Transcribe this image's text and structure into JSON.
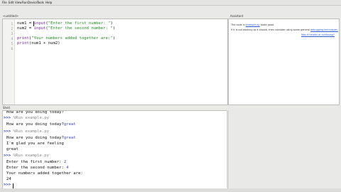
{
  "menu": [
    "File",
    "Edit",
    "View",
    "Run",
    "Device",
    "Tools",
    "Help"
  ],
  "panes": {
    "editor_title": "<untitled>",
    "assistant_title": "Assistant",
    "shell_title": "Shell"
  },
  "editor": {
    "line_numbers": [
      "1",
      "2",
      "3",
      "4",
      "5",
      "6"
    ],
    "lines": [
      {
        "t1": "num1 = ",
        "fn": "input",
        "t2": "(",
        "str": "\"Enter the first number: \"",
        "t3": ")"
      },
      {
        "t1": "num2 = ",
        "fn": "input",
        "t2": "(",
        "str": "\"Enter the second number: \"",
        "t3": ")"
      },
      {
        "t1": "",
        "fn": "",
        "t2": "",
        "str": "",
        "t3": ""
      },
      {
        "t1": "",
        "fn": "print",
        "t2": "(",
        "str": "\"Your numbers added together are:\"",
        "t3": ")"
      },
      {
        "t1": "",
        "fn": "print",
        "t2": "(num1 + num2)",
        "str": "",
        "t3": ""
      }
    ]
  },
  "assistant": {
    "line1_a": "The code in",
    "line1_link": "example.py",
    "line1_b": "looks good.",
    "line2_a": "If it is not working as it should, then consider using some general",
    "line2_link": "debugging techniques.",
    "line3_link": "Was it helpful or confusing?"
  },
  "shell": {
    "lines": [
      {
        "kind": "out",
        "text": "How are you doing today?"
      },
      {
        "kind": "run",
        "prompt": ">>>",
        "text": "%Run example.py"
      },
      {
        "kind": "out",
        "text": "How are you doing today?",
        "input": "great"
      },
      {
        "kind": "run",
        "prompt": ">>>",
        "text": "%Run example.py"
      },
      {
        "kind": "out",
        "text": "How are you doing today?",
        "input": "great"
      },
      {
        "kind": "out",
        "text": "I'm glad you are feeling"
      },
      {
        "kind": "out",
        "text": "great"
      },
      {
        "kind": "run",
        "prompt": ">>>",
        "text": "%Run example.py"
      },
      {
        "kind": "out",
        "text": "Enter the first number: ",
        "input": "2"
      },
      {
        "kind": "out",
        "text": "Enter the second number: ",
        "input": "4"
      },
      {
        "kind": "out",
        "text": "Your numbers added together are:"
      },
      {
        "kind": "out",
        "text": "24"
      },
      {
        "kind": "prompt",
        "prompt": ">>>",
        "text": ""
      }
    ]
  }
}
